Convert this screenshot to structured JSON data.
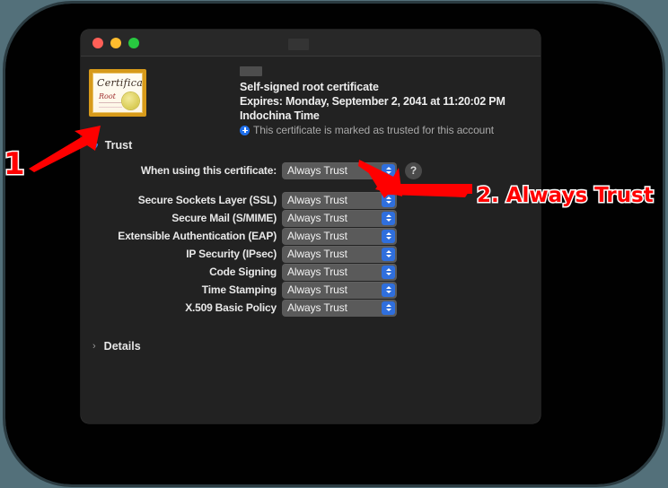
{
  "window": {
    "traffic_lights": [
      "close",
      "minimize",
      "maximize"
    ],
    "title_redacted": true
  },
  "certificate": {
    "thumbnail": {
      "word_certificate": "Certificate",
      "word_root": "Root",
      "seal": "gold-seal"
    },
    "name_redacted": true,
    "subtitle": "Self-signed root certificate",
    "expires": "Expires: Monday, September 2, 2041 at 11:20:02 PM Indochina Time",
    "trusted_status": "This certificate is marked as trusted for this account",
    "trusted_icon": "plus-circle-icon"
  },
  "trust": {
    "heart_icon": "♥",
    "section_label": "Trust",
    "help_label": "?",
    "rows": [
      {
        "label": "When using this certificate:",
        "value": "Always Trust",
        "has_help": true
      },
      {
        "label": "Secure Sockets Layer (SSL)",
        "value": "Always Trust",
        "has_help": false
      },
      {
        "label": "Secure Mail (S/MIME)",
        "value": "Always Trust",
        "has_help": false
      },
      {
        "label": "Extensible Authentication (EAP)",
        "value": "Always Trust",
        "has_help": false
      },
      {
        "label": "IP Security (IPsec)",
        "value": "Always Trust",
        "has_help": false
      },
      {
        "label": "Code Signing",
        "value": "Always Trust",
        "has_help": false
      },
      {
        "label": "Time Stamping",
        "value": "Always Trust",
        "has_help": false
      },
      {
        "label": "X.509 Basic Policy",
        "value": "Always Trust",
        "has_help": false
      }
    ]
  },
  "details": {
    "chevron": "›",
    "label": "Details"
  },
  "annotations": {
    "step1_label": "1",
    "step2_label": "2. Always Trust",
    "color": "#ff0000",
    "outline_color": "#ffffff"
  },
  "colors": {
    "canvas": "#53707a",
    "backdrop": "#010101",
    "window_bg": "#222222",
    "titlebar_bg": "#282828",
    "popup_bg": "#5a5a5a",
    "accent_blue": "#2f6fdd",
    "trust_heart": "#2f7fe0",
    "info_blue": "#1f6feb"
  }
}
